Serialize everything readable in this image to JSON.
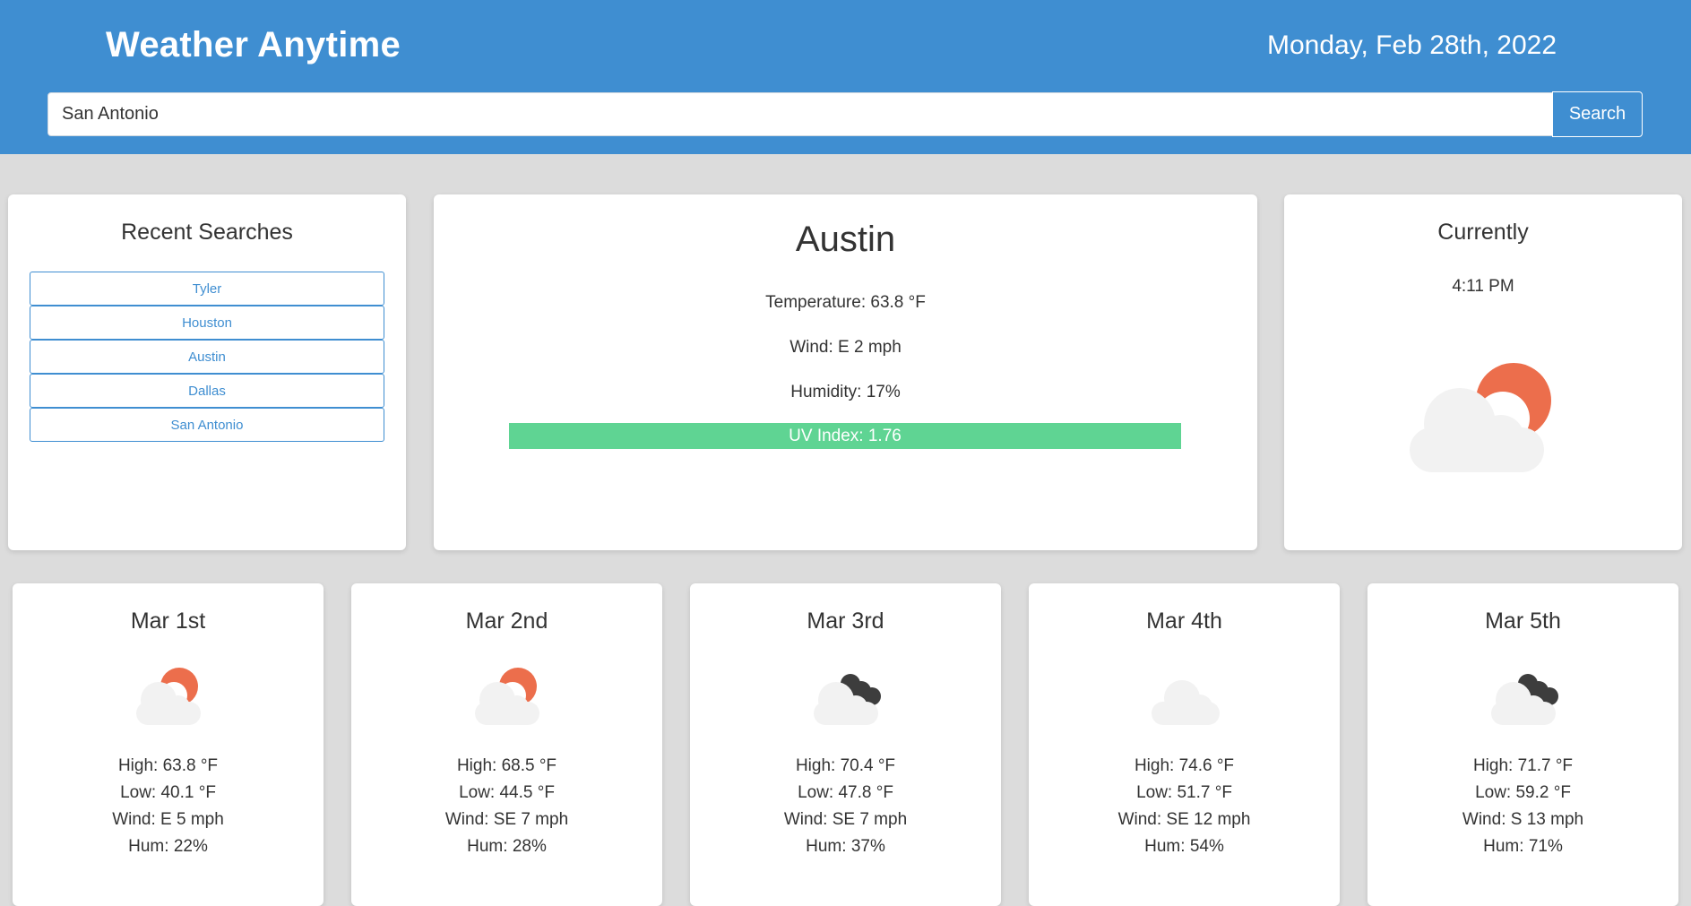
{
  "header": {
    "title": "Weather Anytime",
    "date": "Monday, Feb 28th, 2022",
    "background_color": "#3f8ed1"
  },
  "search": {
    "value": "San Antonio",
    "button_label": "Search"
  },
  "recent": {
    "title": "Recent Searches",
    "items": [
      "Tyler",
      "Houston",
      "Austin",
      "Dallas",
      "San Antonio"
    ]
  },
  "main": {
    "city": "Austin",
    "temperature": "Temperature: 63.8 °F",
    "wind": "Wind: E 2 mph",
    "humidity": "Humidity: 17%",
    "uv": "UV Index: 1.76",
    "uv_color": "#5fd493"
  },
  "current": {
    "title": "Currently",
    "time": "4:11 PM",
    "icon": "partly-cloudy-day-icon"
  },
  "forecast": [
    {
      "date": "Mar 1st",
      "icon": "partly-cloudy-day-icon",
      "high": "High: 63.8 °F",
      "low": "Low: 40.1 °F",
      "wind": "Wind: E 5 mph",
      "hum": "Hum: 22%"
    },
    {
      "date": "Mar 2nd",
      "icon": "partly-cloudy-day-icon",
      "high": "High: 68.5 °F",
      "low": "Low: 44.5 °F",
      "wind": "Wind: SE 7 mph",
      "hum": "Hum: 28%"
    },
    {
      "date": "Mar 3rd",
      "icon": "dark-clouds-icon",
      "high": "High: 70.4 °F",
      "low": "Low: 47.8 °F",
      "wind": "Wind: SE 7 mph",
      "hum": "Hum: 37%"
    },
    {
      "date": "Mar 4th",
      "icon": "cloud-icon",
      "high": "High: 74.6 °F",
      "low": "Low: 51.7 °F",
      "wind": "Wind: SE 12 mph",
      "hum": "Hum: 54%"
    },
    {
      "date": "Mar 5th",
      "icon": "dark-clouds-icon",
      "high": "High: 71.7 °F",
      "low": "Low: 59.2 °F",
      "wind": "Wind: S 13 mph",
      "hum": "Hum: 71%"
    }
  ]
}
